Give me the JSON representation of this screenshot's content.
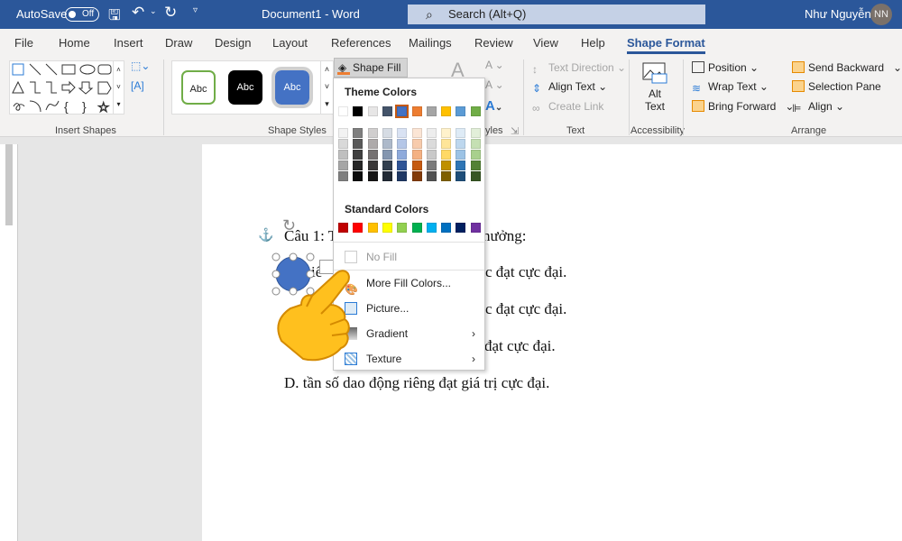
{
  "titlebar": {
    "autosave": "AutoSave",
    "autosave_state": "Off",
    "doc_title": "Document1  -  Word",
    "search_placeholder": "Search (Alt+Q)",
    "user_name": "Như Nguyễn",
    "user_initials": "NN",
    "bg_color": "#2b579a"
  },
  "tabs": [
    "File",
    "Home",
    "Insert",
    "Draw",
    "Design",
    "Layout",
    "References",
    "Mailings",
    "Review",
    "View",
    "Help",
    "Shape Format"
  ],
  "active_tab": "Shape Format",
  "ribbon": {
    "groups": {
      "insert_shapes": "Insert Shapes",
      "shape_styles": "Shape Styles",
      "wordart_styles_partial": "yles",
      "text": "Text",
      "accessibility": "Accessibility",
      "arrange": "Arrange"
    },
    "style_samples": [
      "Abc",
      "Abc",
      "Abc"
    ],
    "shape_fill": "Shape Fill",
    "text_direction": "Text Direction",
    "align_text": "Align Text",
    "create_link": "Create Link",
    "alt_text": [
      "Alt",
      "Text"
    ],
    "position": "Position",
    "wrap_text": "Wrap Text",
    "bring_forward": "Bring Forward",
    "send_backward": "Send Backward",
    "selection_pane": "Selection Pane",
    "align": "Align"
  },
  "shape_fill_menu": {
    "theme_colors_label": "Theme Colors",
    "theme_colors": [
      "#ffffff",
      "#000000",
      "#e7e6e6",
      "#44546a",
      "#4472c4",
      "#ed7d31",
      "#a5a5a5",
      "#ffc000",
      "#5b9bd5",
      "#70ad47"
    ],
    "theme_shades": [
      [
        "#f2f2f2",
        "#d9d9d9",
        "#bfbfbf",
        "#a6a6a6",
        "#7f7f7f"
      ],
      [
        "#7f7f7f",
        "#595959",
        "#404040",
        "#262626",
        "#0d0d0d"
      ],
      [
        "#d0cece",
        "#aeaaaa",
        "#757171",
        "#3a3838",
        "#171616"
      ],
      [
        "#d6dce4",
        "#adb9ca",
        "#8496b0",
        "#323f4f",
        "#222a35"
      ],
      [
        "#d9e2f3",
        "#b4c6e7",
        "#8eaadb",
        "#2f5496",
        "#1f3864"
      ],
      [
        "#fbe5d5",
        "#f7cbac",
        "#f4b183",
        "#c55a11",
        "#833c0b"
      ],
      [
        "#ededed",
        "#dbdbdb",
        "#c9c9c9",
        "#7b7b7b",
        "#525252"
      ],
      [
        "#fff2cc",
        "#fee599",
        "#ffd965",
        "#bf9000",
        "#7f6000"
      ],
      [
        "#deebf6",
        "#bdd7ee",
        "#9cc3e5",
        "#2e75b5",
        "#1e4e79"
      ],
      [
        "#e2efd9",
        "#c5e0b3",
        "#a8d08d",
        "#538135",
        "#375623"
      ]
    ],
    "standard_colors_label": "Standard Colors",
    "standard_colors": [
      "#c00000",
      "#ff0000",
      "#ffc000",
      "#ffff00",
      "#92d050",
      "#00b050",
      "#00b0f0",
      "#0070c0",
      "#002060",
      "#7030a0"
    ],
    "items": [
      {
        "label": "No Fill",
        "disabled": true
      },
      {
        "label": "More Fill Colors..."
      },
      {
        "label": "Picture..."
      },
      {
        "label": "Gradient",
        "submenu": true
      },
      {
        "label": "Texture",
        "submenu": true
      }
    ]
  },
  "document": {
    "lines": [
      "Câu 1: T",
      "hưởng:",
      "c đạt cực đại.",
      "c đạt cực đại.",
      "đạt cực đại.",
      "D. tần số dao động riêng đạt giá trị cực đại."
    ],
    "partial_word": "iế"
  },
  "selected_shape_color": "#4472c4"
}
